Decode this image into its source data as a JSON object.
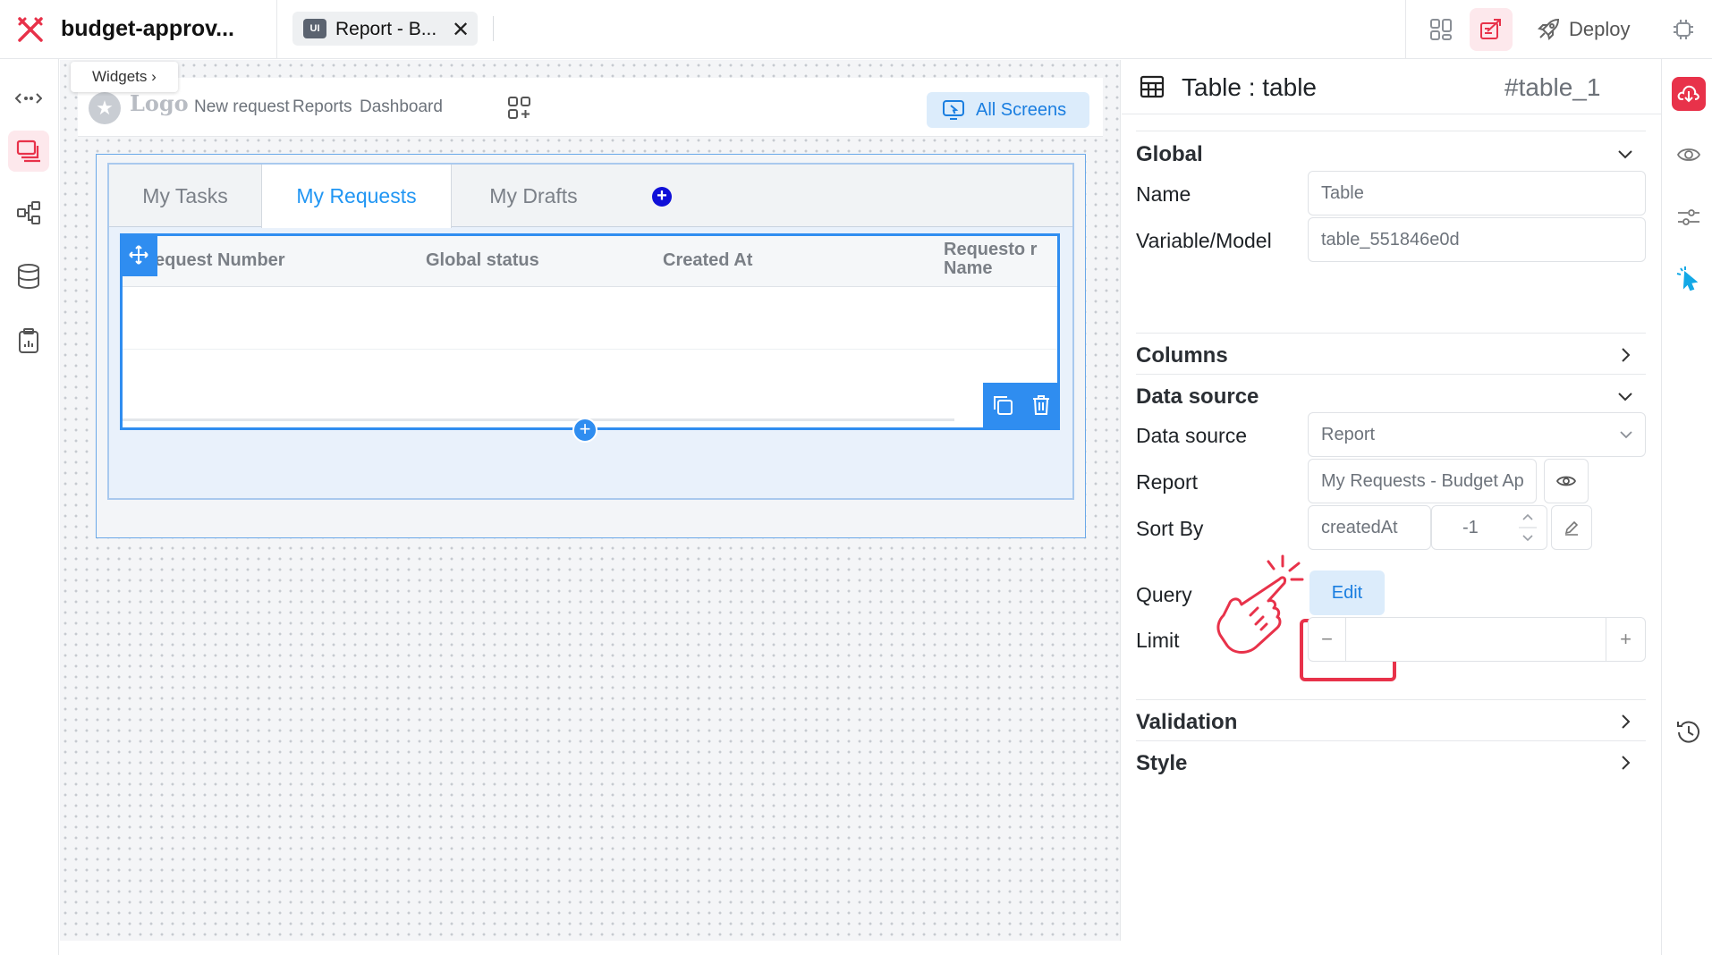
{
  "header": {
    "app_title": "budget-approv...",
    "tab_label": "Report - B...",
    "tab_badge": "UI",
    "tab_close": "✕",
    "deploy_label": "Deploy"
  },
  "canvas": {
    "breadcrumb": "Widgets ›",
    "nav": {
      "logo_text": "Logo",
      "links": [
        "New request",
        "Reports",
        "Dashboard"
      ],
      "all_screens_label": "All Screens"
    },
    "tabs": [
      "My Tasks",
      "My Requests",
      "My Drafts"
    ],
    "active_tab": "My Requests",
    "table": {
      "columns": [
        "equest Number",
        "Global status",
        "Created At",
        "Requesto r Name"
      ]
    }
  },
  "panel": {
    "title": "Table : table",
    "widget_id": "#table_1",
    "sections": {
      "global": "Global",
      "columns": "Columns",
      "data_source": "Data source",
      "validation": "Validation",
      "style": "Style"
    },
    "props": {
      "name_label": "Name",
      "name_value": "Table",
      "variable_label": "Variable/Model",
      "variable_value": "table_551846e0d",
      "data_source_label": "Data source",
      "data_source_value": "Report",
      "report_label": "Report",
      "report_value": "My Requests - Budget Ap",
      "sort_by_label": "Sort By",
      "sort_by_value": "createdAt",
      "sort_order_value": "-1",
      "query_label": "Query",
      "query_button": "Edit",
      "limit_label": "Limit",
      "limit_minus": "−",
      "limit_plus": "+"
    }
  },
  "colors": {
    "brand_red": "#e8324a",
    "accent_blue": "#2f8df0",
    "tab_active_blue": "#2196f3"
  },
  "icons": {
    "brand": "x-logo-icon",
    "pointer_hand": "pointing-hand-icon"
  }
}
